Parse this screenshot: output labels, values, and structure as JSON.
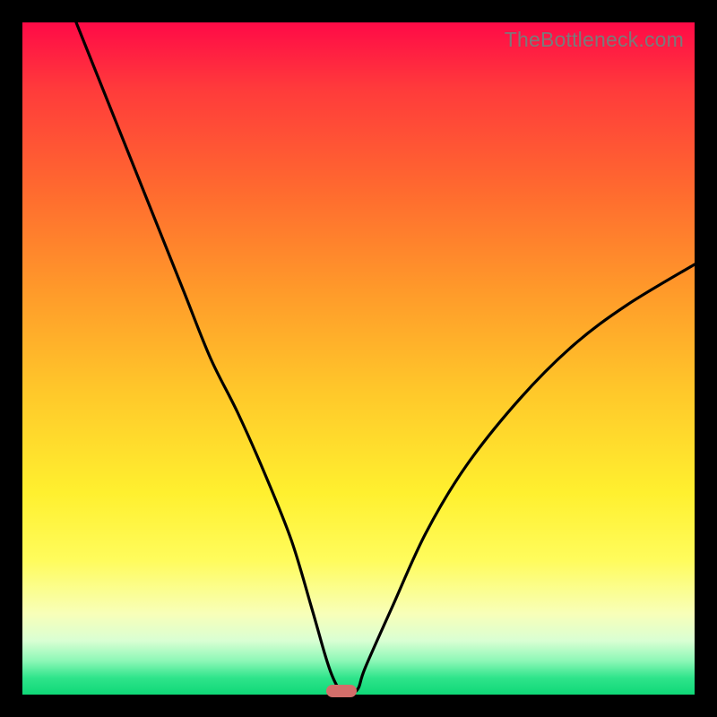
{
  "watermark": "TheBottleneck.com",
  "chart_data": {
    "type": "line",
    "title": "",
    "xlabel": "",
    "ylabel": "",
    "xlim": [
      0,
      100
    ],
    "ylim": [
      0,
      100
    ],
    "grid": false,
    "legend": false,
    "series": [
      {
        "name": "bottleneck-curve",
        "x": [
          8,
          12,
          16,
          20,
          24,
          28,
          32,
          36,
          40,
          43,
          45,
          46,
          47,
          48,
          49,
          50,
          51,
          55,
          60,
          66,
          74,
          82,
          90,
          100
        ],
        "y": [
          100,
          90,
          80,
          70,
          60,
          50,
          42,
          33,
          23,
          13,
          6,
          3,
          1,
          0.2,
          0.2,
          1,
          4,
          13,
          24,
          34,
          44,
          52,
          58,
          64
        ]
      }
    ],
    "marker": {
      "x": 47.5,
      "y": 0.5,
      "color": "#d36e6a"
    },
    "background_gradient": {
      "top": "#ff0a47",
      "bottom": "#0fd877",
      "meaning": "red = high bottleneck, green = low bottleneck"
    }
  }
}
